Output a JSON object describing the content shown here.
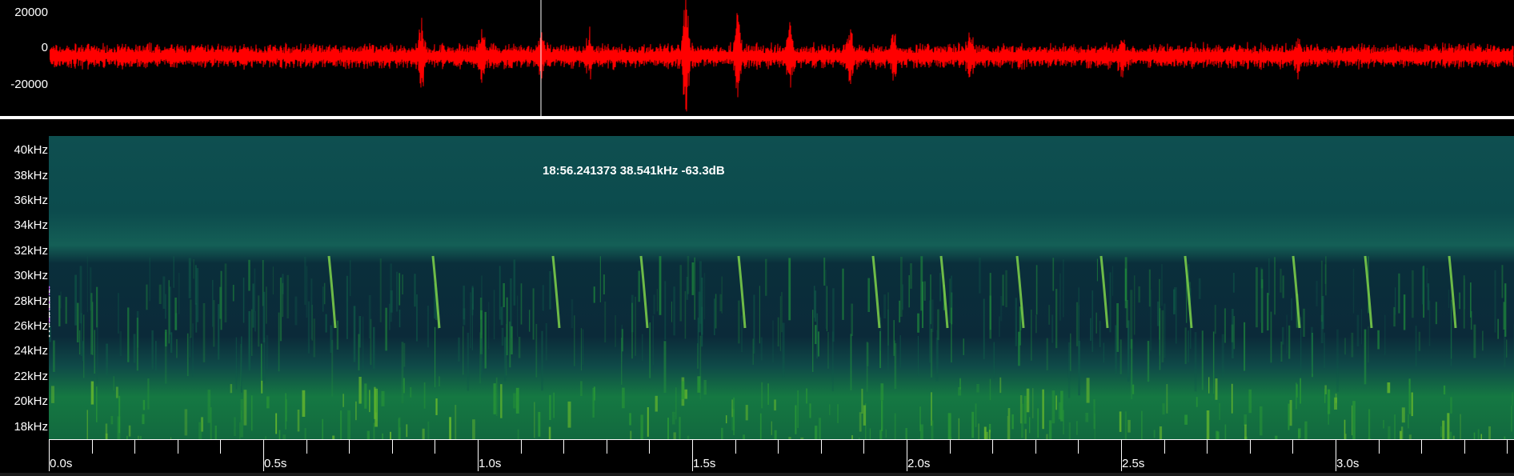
{
  "waveform": {
    "amplitude_labels": [
      "20000",
      "0",
      "-20000"
    ],
    "trace_color": "#ff0000",
    "cursor_color": "#ffffff"
  },
  "spectrogram": {
    "frequency_labels": [
      "40kHz",
      "38kHz",
      "36kHz",
      "34kHz",
      "32kHz",
      "30kHz",
      "28kHz",
      "26kHz",
      "24kHz",
      "22kHz",
      "20kHz",
      "18kHz"
    ],
    "readout": "18:56.241373 38.541kHz -63.3dB"
  },
  "time_axis": {
    "labels": [
      "0.0s",
      "0.5s",
      "1.0s",
      "1.5s",
      "2.0s",
      "2.5s",
      "3.0s"
    ]
  }
}
